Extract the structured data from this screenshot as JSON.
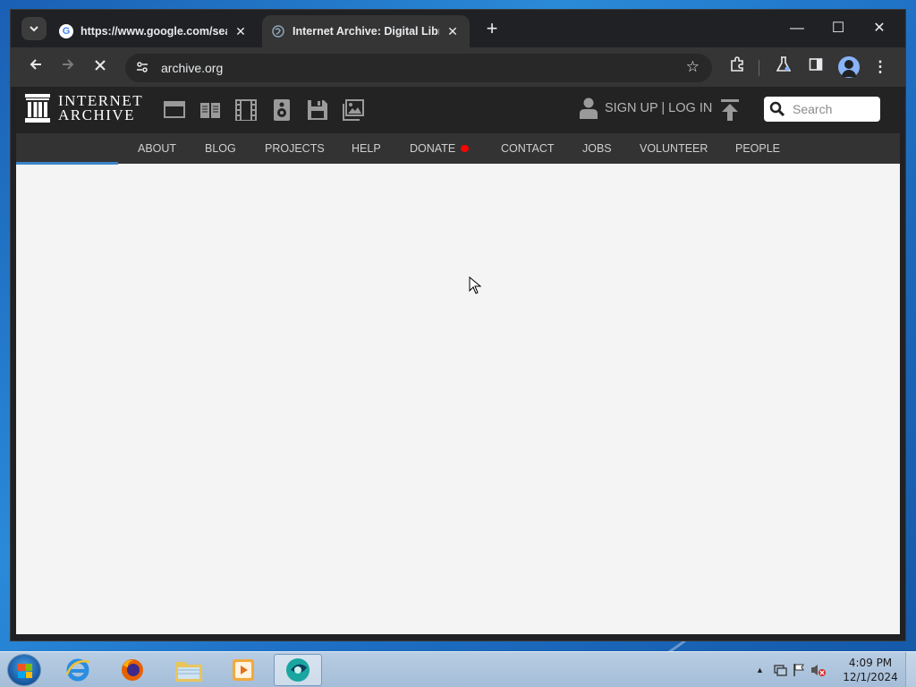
{
  "browser": {
    "tabs": [
      {
        "title": "https://www.google.com/search?q=internet+archive",
        "active": false
      },
      {
        "title": "Internet Archive: Digital Library",
        "active": true
      }
    ],
    "address": "archive.org"
  },
  "site": {
    "logo_line1": "INTERNET",
    "logo_line2": "ARCHIVE",
    "signin_label": "SIGN UP | LOG IN",
    "search_placeholder": "Search",
    "nav": [
      "ABOUT",
      "BLOG",
      "PROJECTS",
      "HELP",
      "DONATE",
      "CONTACT",
      "JOBS",
      "VOLUNTEER",
      "PEOPLE"
    ]
  },
  "taskbar": {
    "time": "4:09 PM",
    "date": "12/1/2024"
  },
  "colors": {
    "donate_heart": "#ff0100",
    "loading_bar": "#3b82c8",
    "ia_header": "#232323",
    "ia_nav": "#333333"
  }
}
